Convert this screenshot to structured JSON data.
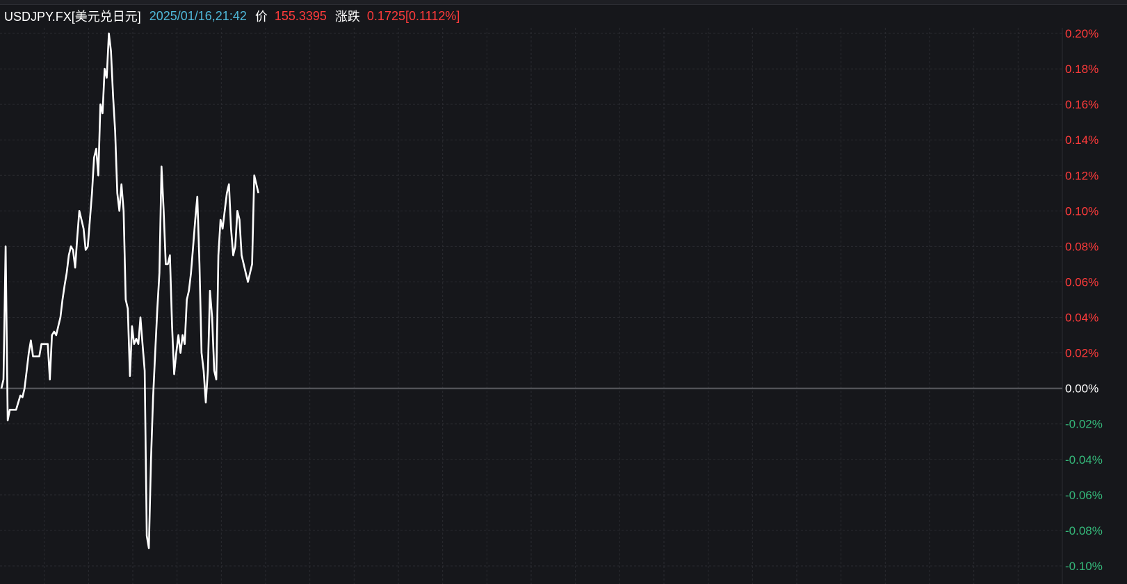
{
  "header": {
    "symbol": "USDJPY.FX[美元兑日元]",
    "datetime": "2025/01/16,21:42",
    "price_label": "价",
    "price_value": "155.3395",
    "change_label": "涨跌",
    "change_value": "0.1725[0.1112%]"
  },
  "colors": {
    "background": "#16171b",
    "grid": "#2a2b30",
    "zero_line": "#5a5b60",
    "line": "#ffffff",
    "positive": "#ff3b3b",
    "negative": "#35b87a",
    "neutral": "#ffffff",
    "time_text": "#4fb8d9"
  },
  "chart_data": {
    "type": "line",
    "ylim": [
      -0.1,
      0.2
    ],
    "y_ticks": [
      0.2,
      0.18,
      0.16,
      0.14,
      0.12,
      0.1,
      0.08,
      0.06,
      0.04,
      0.02,
      0.0,
      -0.02,
      -0.04,
      -0.06,
      -0.08,
      -0.1
    ],
    "y_tick_labels": [
      "0.20%",
      "0.18%",
      "0.16%",
      "0.14%",
      "0.12%",
      "0.10%",
      "0.08%",
      "0.06%",
      "0.04%",
      "0.02%",
      "0.00%",
      "-0.02%",
      "-0.04%",
      "-0.06%",
      "-0.08%",
      "-0.10%"
    ],
    "grid": true,
    "x_grid_count": 24,
    "x_index_max": 480,
    "series": [
      {
        "values": [
          0.0,
          0.005,
          0.08,
          -0.018,
          -0.012,
          -0.012,
          -0.012,
          -0.012,
          -0.008,
          -0.004,
          -0.005,
          0.0,
          0.01,
          0.02,
          0.027,
          0.018,
          0.018,
          0.018,
          0.018,
          0.025,
          0.025,
          0.025,
          0.025,
          0.005,
          0.03,
          0.032,
          0.03,
          0.035,
          0.04,
          0.05,
          0.058,
          0.065,
          0.075,
          0.08,
          0.078,
          0.068,
          0.085,
          0.1,
          0.095,
          0.09,
          0.078,
          0.08,
          0.095,
          0.11,
          0.13,
          0.135,
          0.12,
          0.16,
          0.155,
          0.18,
          0.175,
          0.2,
          0.19,
          0.165,
          0.145,
          0.11,
          0.1,
          0.115,
          0.1,
          0.05,
          0.045,
          0.007,
          0.035,
          0.025,
          0.028,
          0.025,
          0.04,
          0.025,
          0.01,
          -0.083,
          -0.09,
          -0.04,
          -0.005,
          0.02,
          0.045,
          0.065,
          0.125,
          0.1,
          0.07,
          0.07,
          0.075,
          0.035,
          0.008,
          0.02,
          0.03,
          0.02,
          0.03,
          0.025,
          0.05,
          0.055,
          0.065,
          0.08,
          0.095,
          0.108,
          0.07,
          0.02,
          0.01,
          -0.008,
          0.01,
          0.055,
          0.04,
          0.01,
          0.005,
          0.075,
          0.095,
          0.09,
          0.1,
          0.11,
          0.115,
          0.09,
          0.075,
          0.08,
          0.1,
          0.095,
          0.075,
          0.07,
          0.065,
          0.06,
          0.065,
          0.07,
          0.12,
          0.115,
          0.11
        ]
      }
    ]
  }
}
